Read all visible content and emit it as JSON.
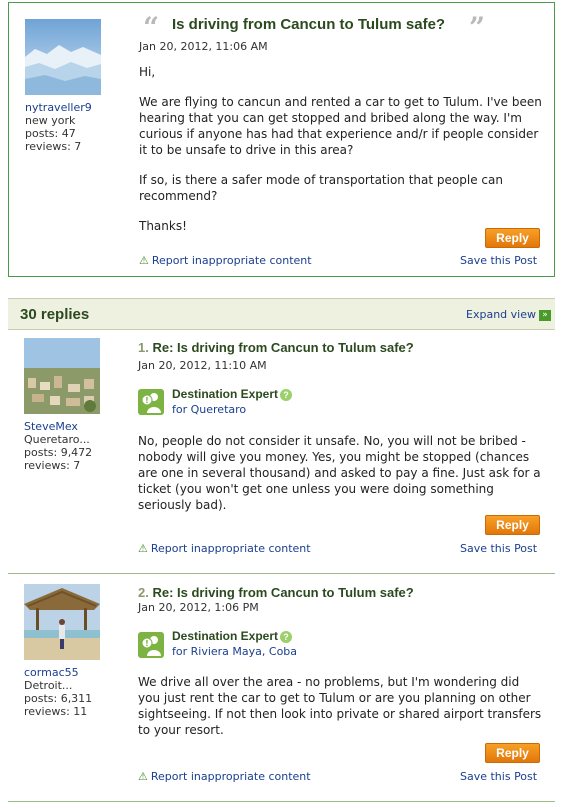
{
  "original": {
    "username": "nytraveller9",
    "location": "new york",
    "posts": "posts: 47",
    "reviews": "reviews: 7",
    "title": "Is driving from Cancun to Tulum safe?",
    "date": "Jan 20, 2012, 11:06 AM",
    "paragraphs": [
      "Hi,",
      "We are flying to cancun and rented a car to get to Tulum. I've been hearing that you can get stopped and bribed along the way. I'm curious if anyone has had that experience and/r if people consider it to be unsafe to drive in this area?",
      "If so, is there a safer mode of transportation that people can recommend?",
      "Thanks!"
    ],
    "reply_label": "Reply",
    "report_label": "Report inappropriate content",
    "save_label": "Save this Post"
  },
  "replies_header": {
    "count": "30 replies",
    "expand_label": "Expand view"
  },
  "replies": [
    {
      "number": "1.",
      "title": "Re: Is driving from Cancun to Tulum safe?",
      "date": "Jan 20, 2012, 11:10 AM",
      "username": "SteveMex",
      "location": "Queretaro...",
      "posts": "posts: 9,472",
      "reviews": "reviews: 7",
      "expert_label": "Destination Expert",
      "expert_for": "for Queretaro",
      "body": "No, people do not consider it unsafe. No, you will not be bribed - nobody will give you money. Yes, you might be stopped (chances are one in several thousand) and asked to pay a fine. Just ask for a ticket (you won't get one unless you were doing something seriously bad).",
      "reply_label": "Reply",
      "report_label": "Report inappropriate content",
      "save_label": "Save this Post"
    },
    {
      "number": "2.",
      "title": "Re: Is driving from Cancun to Tulum safe?",
      "date": "Jan 20, 2012, 1:06 PM",
      "username": "cormac55",
      "location": "Detroit...",
      "posts": "posts: 6,311",
      "reviews": "reviews: 11",
      "expert_label": "Destination Expert",
      "expert_for": "for Riviera Maya, Coba",
      "body": "We drive all over the area - no problems, but I'm wondering did you just rent the car to get to Tulum or are you planning on other sightseeing. If not then look into private or shared airport transfers to your resort.",
      "reply_label": "Reply",
      "report_label": "Report inappropriate content",
      "save_label": "Save this Post"
    }
  ],
  "icons": {
    "quote_open": "quote-open-icon",
    "quote_close": "quote-close-icon",
    "warning": "warning-icon",
    "expand": "expand-arrow-icon",
    "expert_badge": "destination-expert-icon",
    "help": "help-question-icon"
  },
  "colors": {
    "accent_green": "#2c4a1f",
    "border_green": "#4b9a4b",
    "reply_orange": "#f08c1a",
    "link_blue": "#1a3f8f"
  }
}
